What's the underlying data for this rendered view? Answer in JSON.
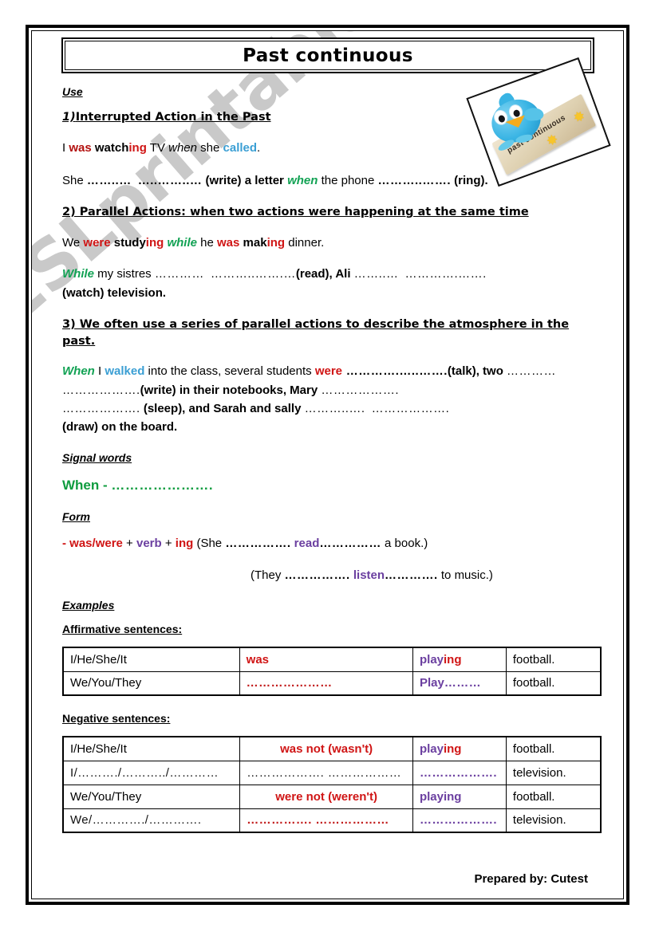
{
  "document": {
    "title": "Past continuous",
    "watermark": "ESLprintables.com",
    "credit": "Prepared by: Cutest"
  },
  "illustration": {
    "name": "bird-with-sign",
    "sign_label": "past continuous",
    "sparkle": "✸"
  },
  "sections": {
    "use_heading": "Use",
    "rule1": {
      "heading": "1)Interrupted Action in the Past",
      "example": {
        "t1": "I ",
        "was": "was",
        "t2": " watch",
        "ing": "ing",
        "t3": " TV ",
        "when": "when",
        "t4": " she ",
        "called": "called",
        "t5": "."
      },
      "exercise": {
        "t1": "She ",
        "d1": "……..…",
        "d2": "…..……..…",
        "t2": " (write) a letter ",
        "when": "when",
        "t3": " the phone ",
        "d3": "………..…….",
        "t4": " (ring)."
      }
    },
    "rule2": {
      "heading": "2) Parallel Actions: when two actions were happening at the same time",
      "example": {
        "t1": "We ",
        "were": "were",
        "t2": " study",
        "ing1": "ing",
        "t3": " ",
        "while": "while",
        "t4": " he ",
        "was": "was",
        "t5": " mak",
        "ing2": "ing",
        "t6": " dinner."
      },
      "exercise": {
        "while": "While",
        "t1": " my sistres ",
        "d1": "…………",
        "d2": "………..…….…",
        "t2": "(read), Ali ",
        "d3": "……..…",
        "d4": "………….…….",
        "t3": "(watch) television."
      }
    },
    "rule3": {
      "heading": "3) We often use a series of parallel actions to describe the atmosphere in the past.",
      "exercise": {
        "when": "When",
        "t1": " I ",
        "walked": "walked",
        "t2": " into the class, several students ",
        "were": "were",
        "d1": " ………….…..…….",
        "t3": "(talk), two ",
        "d2": "…………",
        "d3": "……………….",
        "t4": "(write) in their notebooks, Mary ",
        "d4": "……………….",
        "d5": "……………….",
        "t5": " (sleep), and Sarah and sally ",
        "d6": "………..….",
        "d7": "……………….",
        "t6": "(draw) on the board."
      }
    },
    "signal_words": {
      "heading": "Signal words",
      "when": "When",
      "dash": " - ",
      "dots": "…………………."
    },
    "form": {
      "heading": "Form",
      "line1": {
        "dash": "- ",
        "was_were": "was/were",
        "plus1": " + ",
        "verb": "verb",
        "plus2": " + ",
        "ing": "ing",
        "t1": " (She ",
        "d1": "…………….",
        "read": " read",
        "d2": "……………",
        "t2": " a book.)"
      },
      "line2": {
        "t1": "(They ",
        "d1": "…………….",
        "listen": " listen",
        "d2": "………….",
        "t2": " to music.)"
      }
    },
    "examples": {
      "heading": "Examples",
      "affirmative_heading": "Affirmative sentences:",
      "negative_heading": "Negative sentences:"
    }
  },
  "affirmative_table": {
    "rows": [
      {
        "subject": "I/He/She/It",
        "aux": "was",
        "verb_stem": "play",
        "verb_ing": "ing",
        "object": "football."
      },
      {
        "subject": "We/You/They",
        "aux": "…………………",
        "verb_stem": "Play",
        "verb_ing": "………",
        "object": "football."
      }
    ]
  },
  "negative_table": {
    "rows": [
      {
        "subject": "I/He/She/It",
        "aux": "was not (wasn't)",
        "verb_stem": "play",
        "verb_ing": "ing",
        "object": "football."
      },
      {
        "subject": "I/………./………../…………",
        "aux": "……………….  ………………",
        "verb_stem": "……………….",
        "verb_ing": "",
        "object": "television."
      },
      {
        "subject": "We/You/They",
        "aux": "were not (weren't)",
        "verb_stem": "play",
        "verb_ing": "ing",
        "object": "football."
      },
      {
        "subject": "We/…………./………….",
        "aux": "……………. ………………",
        "verb_stem": "……………….",
        "verb_ing": "",
        "object": "television."
      }
    ]
  },
  "colors": {
    "red": "#d01515",
    "green": "#12a254",
    "blue": "#3b9fd4",
    "purple": "#6b3fa0",
    "watermark_gray": "#c9c9c9"
  }
}
